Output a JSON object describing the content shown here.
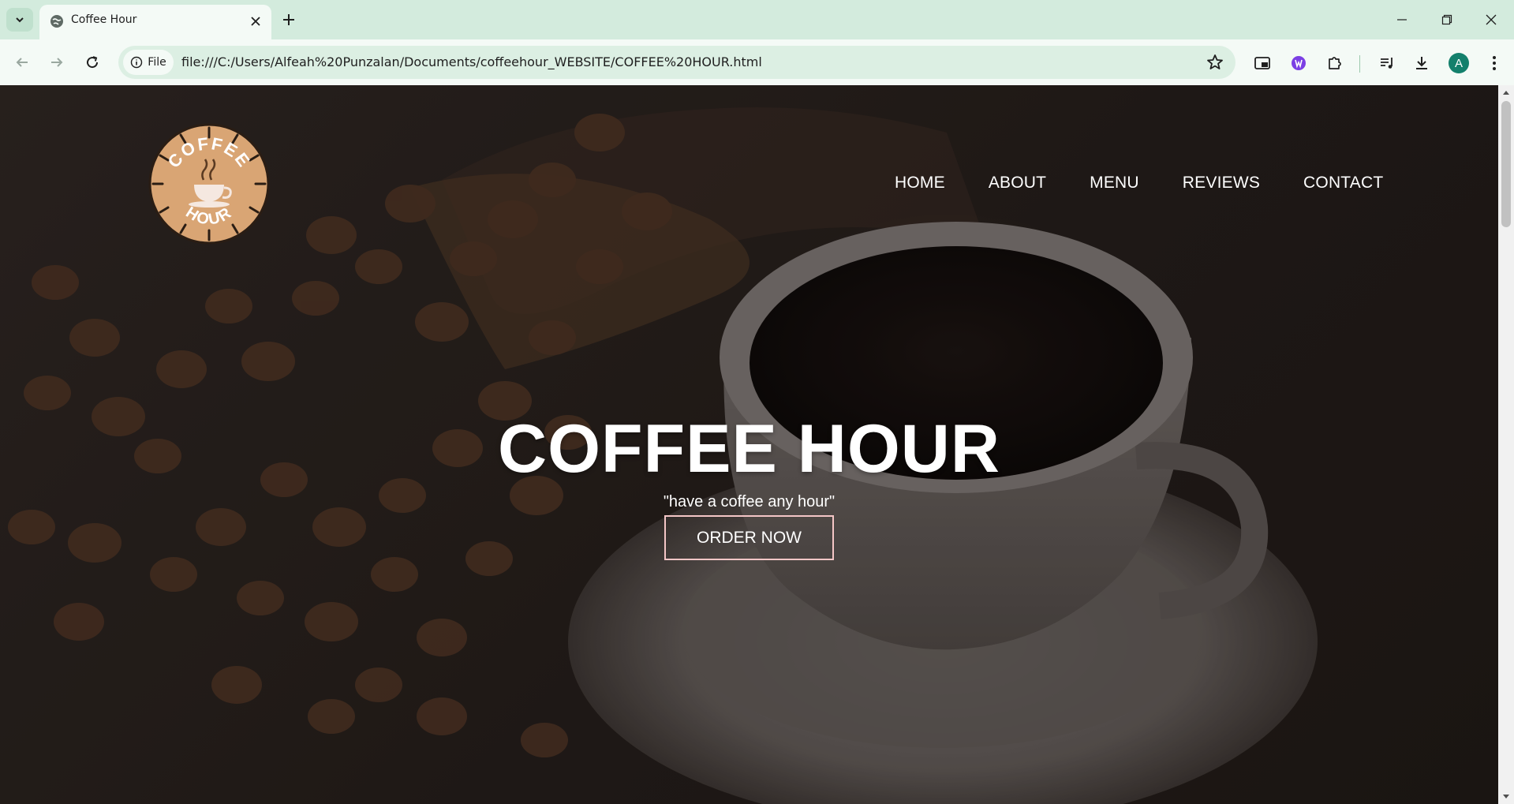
{
  "browser": {
    "tab_title": "Coffee Hour",
    "file_chip_label": "File",
    "url": "file:///C:/Users/Alfeah%20Punzalan/Documents/coffeehour_WEBSITE/COFFEE%20HOUR.html",
    "profile_initial": "A",
    "colors": {
      "frame": "#d3ebdd",
      "toolbar": "#f4faf6",
      "omnibox": "#dcefe3",
      "avatar": "#13806c"
    }
  },
  "site": {
    "logo": {
      "top_text": "COFFEE",
      "bottom_text": "HOUR"
    },
    "nav": [
      {
        "label": "HOME"
      },
      {
        "label": "ABOUT"
      },
      {
        "label": "MENU"
      },
      {
        "label": "REVIEWS"
      },
      {
        "label": "CONTACT"
      }
    ],
    "hero": {
      "title": "COFFEE HOUR",
      "subtitle": "\"have a coffee any hour\"",
      "cta_label": "ORDER NOW"
    },
    "colors": {
      "logo_fill": "#d9a574",
      "cta_border": "#f4c6c6",
      "text": "#ffffff"
    }
  }
}
